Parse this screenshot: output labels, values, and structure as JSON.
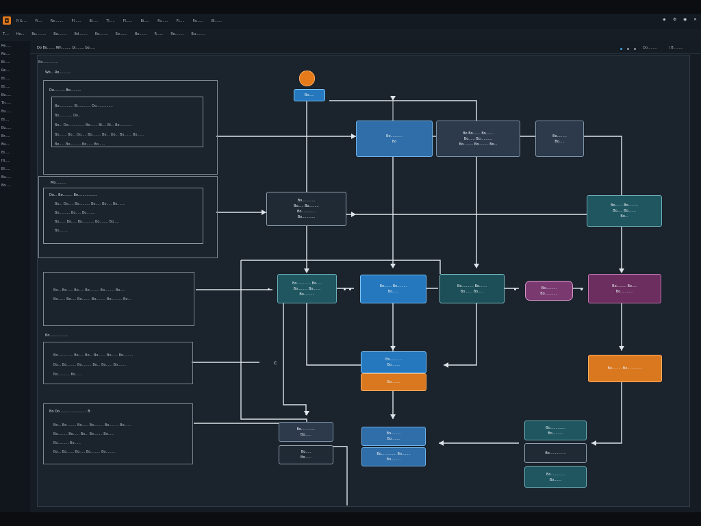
{
  "app": {
    "logo_glyph": "◘"
  },
  "menubar": {
    "items": [
      "R & ...",
      "Fi....",
      "Re........",
      "Fl......",
      "Bi.....",
      "Tl.....",
      "Fl......",
      "Bi.....",
      "Fo......",
      "Fl.....",
      "Fa......",
      "Bl......."
    ]
  },
  "tabbar": {
    "tabs": [
      "T....",
      "Ho...",
      "Bu.........",
      "Ba........",
      "Bd........",
      "Ro........",
      "Eo.......",
      "Bo.......",
      "R......",
      "Re........",
      "Bu........."
    ]
  },
  "sidebar": {
    "items": [
      "Re.....",
      "Re....",
      "Bi.....",
      "Re....",
      "Bi.....",
      "Bl.....",
      "Bo.....",
      "Th.....",
      "Bu.....",
      "Bl....",
      "Bu.....",
      "Br.....",
      "Bu....",
      "Bi.....",
      "Hi.....",
      "Bl.....",
      "Bu.....",
      "Bo....."
    ]
  },
  "panel": {
    "title": "Do Bo.......  Wh.........  bi........  bo.....",
    "right_label_1": "Do.........",
    "right_label_2": "/ B.........",
    "breadcrumb": "Bo.............."
  },
  "left_groups": [
    {
      "heading": "Wo...  Ro...........",
      "outer_label": "Do..........  Bo..........",
      "lines": [
        "Bo.............  Bi............  Do...............",
        "Bo............  Do..",
        "Bo...  Do...............  Bo.......  Bi....  Bi...  Bo............",
        "Bo.......  Bo...  Do.....  Bo........  Bo...  Do...  Bo.......  Bo......",
        "Bo.....  Bo..........  Bo......  Bo......"
      ]
    },
    {
      "heading": "Mo..........",
      "outer_label": "Do...  Bo.........  Bo..................",
      "lines": [
        "Bo...  Do.....  Bo..........  Bo.....  Bo.....  Bo.......",
        "Bo..........  Bo.....  Bo........",
        "Bo......  Bo.....  Bo...........  Bo........  Bo.....",
        "Bo........"
      ]
    },
    {
      "heading": "",
      "outer_label": "",
      "lines": [
        "Bo...  Bo......  Bo.....  Bo.........  Bo.........  Bo.....",
        "Bo.......  Bo.....  Bo........  Bo.........  Bo..........  Bo..."
      ]
    },
    {
      "heading": "Bo.................",
      "outer_label": "",
      "lines": [
        "Bo..............  Bo.....  Bo...  Bo.......  Bo......  Bo.........",
        "Bo...  Bo.........  Bo.........  Bo...  Bo......  Bo........",
        "Bo...........  Bo......"
      ]
    },
    {
      "heading": "",
      "outer_label": "Bo  Do.........................  B",
      "lines": [
        "Bo...  Bo.........  Bo......  Bo.........  Bo.........  Bo......",
        "Bo.........  Bo......  Bo...  Bo........  Bo......",
        "Bo..........  Bo......",
        "Bo...  Bo.......  Bo.....  Bo.........  Bo........."
      ]
    }
  ],
  "nodes": {
    "start": {
      "label": "Bo....."
    },
    "n_blue_top": {
      "line1": "Bo...........",
      "line2": "Bo"
    },
    "n_slate_top": {
      "line1": "Bo  Bo.......  Bo.......",
      "line2": "Bo......  Bo...........",
      "line3": "Bo.........  Bo.........  Bo..."
    },
    "n_dark_top_right": {
      "line1": "Bo.........",
      "line2": "Bo....."
    },
    "n_center_dark": {
      "line1": "Bo............",
      "line2": "Bo.....  Bo.........",
      "line3": "Bo.............",
      "line4": "Bo............"
    },
    "n_teal_right": {
      "line1": "Bo.......  Bo.........",
      "line2": "Bo.....  Bo.......",
      "line3": "Bo..."
    },
    "n_teal_mid": {
      "line1": "Bo.............  Bo.....",
      "line2": "Bo.........  Bo.......",
      "line3": "Bo.........."
    },
    "n_blue_mid": {
      "line1": "Bo.......  Bo.........",
      "line2": "Bo......"
    },
    "n_teal_mid2": {
      "line1": "Bo...........  Bo.......",
      "line2": "Bo.......  Bo....."
    },
    "n_magenta_small": {
      "line1": "Bo..........",
      "line2": "Bo............"
    },
    "n_magenta_right": {
      "line1": "Bo.........  Bo.....",
      "line2": "Bo............"
    },
    "n_blue_stack_top": {
      "line1": "Bo...........",
      "line2": "Bo........"
    },
    "n_orange_stack": {
      "line1": "Bo........"
    },
    "n_orange_right": {
      "line1": "Bo.........  Bo.............."
    },
    "n_slate_bottom_left": {
      "line1": "Bo.............",
      "line2": "Bo......"
    },
    "n_dark_bottom_left": {
      "line1": "Bo.....",
      "line2": "Bo......"
    },
    "n_blue_bottom_1": {
      "line1": "Bo.........",
      "line2": "Bo........"
    },
    "n_blue_bottom_2": {
      "line1": "Bo..............  Bo........",
      "line2": "Bo........."
    },
    "n_teal_bottom_right": {
      "line1": "Bo..............",
      "line2": "Bo.........."
    },
    "n_dark_bottom_right": {
      "line1": "Bo..............."
    },
    "n_teal_bottom_right2": {
      "line1": "Bo.............",
      "line2": "Bo......."
    }
  },
  "colors": {
    "accent_orange": "#e47a1a",
    "node_blue": "#2f6ea8",
    "node_teal": "#1f5660",
    "node_magenta": "#6b2e5e",
    "node_slate": "#2c3a4b",
    "status_blue": "#3aa0e6"
  },
  "icons": [
    "app-logo-icon",
    "window-icons",
    "status-dot-icon",
    "settings-icon"
  ]
}
